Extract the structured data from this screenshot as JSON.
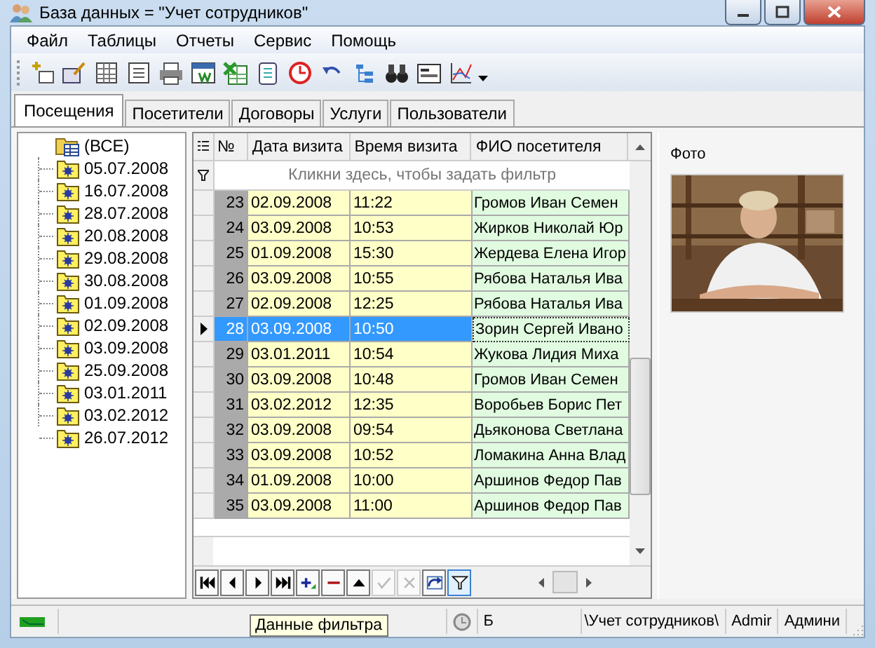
{
  "window": {
    "title": "База данных = \"Учет сотрудников\""
  },
  "menu": [
    "Файл",
    "Таблицы",
    "Отчеты",
    "Сервис",
    "Помощь"
  ],
  "tabs": [
    {
      "label": "Посещения",
      "selected": true
    },
    {
      "label": "Посетители",
      "selected": false
    },
    {
      "label": "Договоры",
      "selected": false
    },
    {
      "label": "Услуги",
      "selected": false
    },
    {
      "label": "Пользователи",
      "selected": false
    }
  ],
  "tree": {
    "label": "(ВСЕ)",
    "selected": false,
    "children": [
      {
        "label": "05.07.2008",
        "selected": false
      },
      {
        "label": "16.07.2008",
        "selected": false
      },
      {
        "label": "28.07.2008",
        "selected": false
      },
      {
        "label": "20.08.2008",
        "selected": false
      },
      {
        "label": "29.08.2008",
        "selected": false
      },
      {
        "label": "30.08.2008",
        "selected": false
      },
      {
        "label": "01.09.2008",
        "selected": false
      },
      {
        "label": "02.09.2008",
        "selected": false
      },
      {
        "label": "03.09.2008",
        "selected": false
      },
      {
        "label": "25.09.2008",
        "selected": false
      },
      {
        "label": "03.01.2011",
        "selected": false
      },
      {
        "label": "03.02.2012",
        "selected": false
      },
      {
        "label": "26.07.2012",
        "selected": false
      }
    ]
  },
  "grid": {
    "columns": [
      "№",
      "Дата визита",
      "Время визита",
      "ФИО посетителя"
    ],
    "filter_hint": "Кликни здесь, чтобы задать фильтр",
    "rows": [
      {
        "n": "23",
        "date": "02.09.2008",
        "time": "11:22",
        "name": "Громов Иван Семен",
        "selected": false
      },
      {
        "n": "24",
        "date": "03.09.2008",
        "time": "10:53",
        "name": "Жирков Николай Юр",
        "selected": false
      },
      {
        "n": "25",
        "date": "01.09.2008",
        "time": "15:30",
        "name": "Жердева Елена Игор",
        "selected": false
      },
      {
        "n": "26",
        "date": "03.09.2008",
        "time": "10:55",
        "name": "Рябова Наталья Ива",
        "selected": false
      },
      {
        "n": "27",
        "date": "02.09.2008",
        "time": "12:25",
        "name": "Рябова Наталья Ива",
        "selected": false
      },
      {
        "n": "28",
        "date": "03.09.2008",
        "time": "10:50",
        "name": "Зорин Сергей Ивано",
        "selected": true
      },
      {
        "n": "29",
        "date": "03.01.2011",
        "time": "10:54",
        "name": "Жукова Лидия Миха",
        "selected": false
      },
      {
        "n": "30",
        "date": "03.09.2008",
        "time": "10:48",
        "name": "Громов Иван Семен",
        "selected": false
      },
      {
        "n": "31",
        "date": "03.02.2012",
        "time": "12:35",
        "name": "Воробьев Борис Пет",
        "selected": false
      },
      {
        "n": "32",
        "date": "03.09.2008",
        "time": "09:54",
        "name": "Дьяконова Светлана",
        "selected": false
      },
      {
        "n": "33",
        "date": "03.09.2008",
        "time": "10:52",
        "name": "Ломакина Анна Влад",
        "selected": false
      },
      {
        "n": "34",
        "date": "01.09.2008",
        "time": "10:00",
        "name": "Аршинов Федор Пав",
        "selected": false
      },
      {
        "n": "35",
        "date": "03.09.2008",
        "time": "11:00",
        "name": "Аршинов Федор Пав",
        "selected": false
      }
    ],
    "navigator": [
      {
        "kind": "first",
        "disabled": false
      },
      {
        "kind": "prior",
        "disabled": false
      },
      {
        "kind": "next",
        "disabled": false
      },
      {
        "kind": "last",
        "disabled": false
      },
      {
        "kind": "insert",
        "disabled": false
      },
      {
        "kind": "delete",
        "disabled": false
      },
      {
        "kind": "edit",
        "disabled": false
      },
      {
        "kind": "post",
        "disabled": true
      },
      {
        "kind": "cancel",
        "disabled": true
      },
      {
        "kind": "refresh",
        "disabled": false
      },
      {
        "kind": "filter",
        "disabled": false
      }
    ]
  },
  "photo": {
    "label": "Фото",
    "kind": "picture"
  },
  "status_bar": {
    "panels": [
      "Б",
      "\\Учет сотрудников\\",
      "Admir",
      "Админи"
    ],
    "tooltip": "Данные фильтра"
  }
}
